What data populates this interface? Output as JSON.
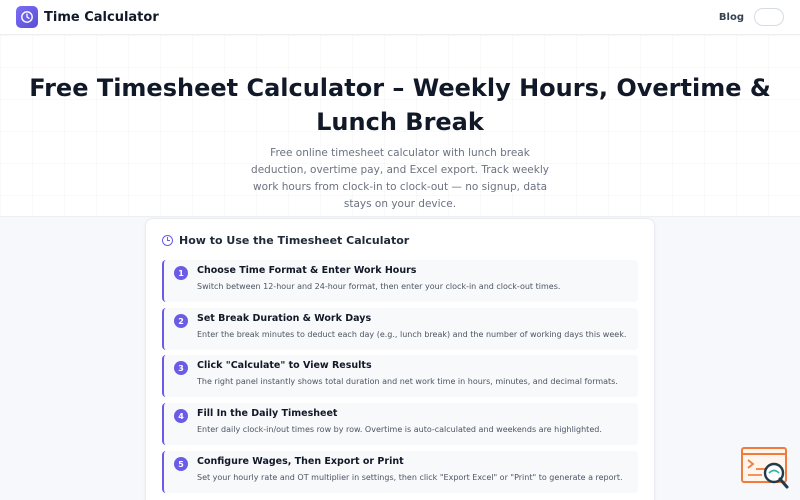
{
  "header": {
    "brand": "Time Calculator",
    "nav_blog": "Blog",
    "lang_label": "",
    "accent": "#6b5ce7"
  },
  "hero": {
    "title": "Free Timesheet Calculator – Weekly Hours, Overtime & Lunch Break",
    "subtitle": "Free online timesheet calculator with lunch break deduction, overtime pay, and Excel export. Track weekly work hours from clock-in to clock-out — no signup, data stays on your device."
  },
  "howto": {
    "icon": "clock-icon",
    "title": "How to Use the Timesheet Calculator",
    "steps": [
      {
        "num": "1",
        "title": "Choose Time Format & Enter Work Hours",
        "desc": "Switch between 12-hour and 24-hour format, then enter your clock-in and clock-out times."
      },
      {
        "num": "2",
        "title": "Set Break Duration & Work Days",
        "desc": "Enter the break minutes to deduct each day (e.g., lunch break) and the number of working days this week."
      },
      {
        "num": "3",
        "title": "Click \"Calculate\" to View Results",
        "desc": "The right panel instantly shows total duration and net work time in hours, minutes, and decimal formats."
      },
      {
        "num": "4",
        "title": "Fill In the Daily Timesheet",
        "desc": "Enter daily clock-in/out times row by row. Overtime is auto-calculated and weekends are highlighted."
      },
      {
        "num": "5",
        "title": "Configure Wages, Then Export or Print",
        "desc": "Set your hourly rate and OT multiplier in settings, then click \"Export Excel\" or \"Print\" to generate a report."
      }
    ]
  },
  "floating_widget": {
    "icon": "search-document-icon"
  }
}
